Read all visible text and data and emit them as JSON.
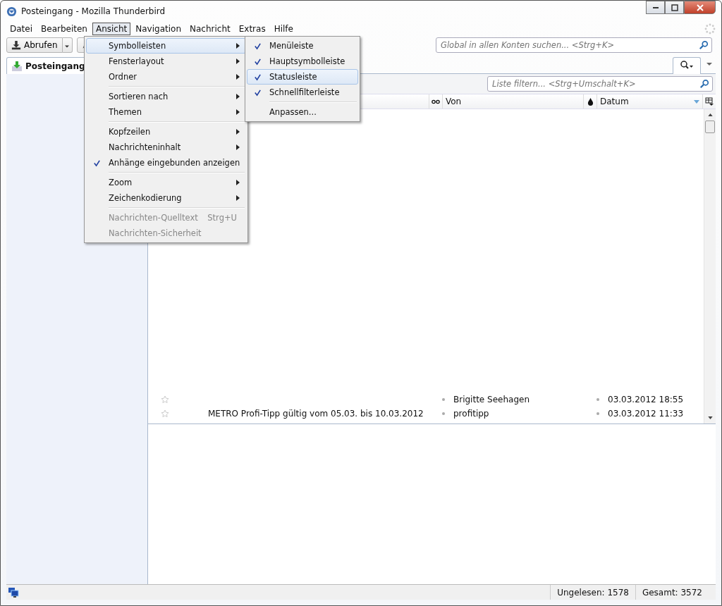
{
  "window": {
    "title": "Posteingang - Mozilla Thunderbird"
  },
  "menubar": [
    {
      "label": "Datei",
      "selected": false
    },
    {
      "label": "Bearbeiten",
      "selected": false
    },
    {
      "label": "Ansicht",
      "selected": true
    },
    {
      "label": "Navigation",
      "selected": false
    },
    {
      "label": "Nachricht",
      "selected": false
    },
    {
      "label": "Extras",
      "selected": false
    },
    {
      "label": "Hilfe",
      "selected": false
    }
  ],
  "toolbar": {
    "get_button": "Abrufen"
  },
  "global_search": {
    "placeholder": "Global in allen Konten suchen... <Strg+K>"
  },
  "tabs": [
    {
      "label": "Posteingang",
      "selected": true
    }
  ],
  "filter": {
    "placeholder": "Liste filtern... <Strg+Umschalt+K>"
  },
  "columns": [
    {
      "label": "Von"
    },
    {
      "label": "Datum"
    }
  ],
  "rows": [
    {
      "subject": "",
      "from": "Brigitte Seehagen",
      "date": "03.03.2012 18:55",
      "starred": false
    },
    {
      "subject": "METRO Profi-Tipp gültig vom 05.03. bis 10.03.2012",
      "from": "profitipp",
      "date": "03.03.2012 11:33",
      "starred": false
    }
  ],
  "view_menu": [
    {
      "kind": "submenu",
      "label": "Symbolleisten",
      "selected": true,
      "checked": false,
      "disabled": false
    },
    {
      "kind": "submenu",
      "label": "Fensterlayout",
      "selected": false,
      "checked": false,
      "disabled": false
    },
    {
      "kind": "submenu",
      "label": "Ordner",
      "selected": false,
      "checked": false,
      "disabled": false
    },
    {
      "kind": "separator"
    },
    {
      "kind": "submenu",
      "label": "Sortieren nach",
      "selected": false,
      "checked": false,
      "disabled": false
    },
    {
      "kind": "submenu",
      "label": "Themen",
      "selected": false,
      "checked": false,
      "disabled": false
    },
    {
      "kind": "separator"
    },
    {
      "kind": "submenu",
      "label": "Kopfzeilen",
      "selected": false,
      "checked": false,
      "disabled": false
    },
    {
      "kind": "submenu",
      "label": "Nachrichteninhalt",
      "selected": false,
      "checked": false,
      "disabled": false
    },
    {
      "kind": "item",
      "label": "Anhänge eingebunden anzeigen",
      "selected": false,
      "checked": true,
      "disabled": false
    },
    {
      "kind": "separator"
    },
    {
      "kind": "submenu",
      "label": "Zoom",
      "selected": false,
      "checked": false,
      "disabled": false
    },
    {
      "kind": "submenu",
      "label": "Zeichenkodierung",
      "selected": false,
      "checked": false,
      "disabled": false
    },
    {
      "kind": "separator"
    },
    {
      "kind": "item",
      "label": "Nachrichten-Quelltext",
      "shortcut": "Strg+U",
      "selected": false,
      "checked": false,
      "disabled": true
    },
    {
      "kind": "item",
      "label": "Nachrichten-Sicherheit",
      "selected": false,
      "checked": false,
      "disabled": true
    }
  ],
  "toolbars_menu": [
    {
      "kind": "item",
      "label": "Menüleiste",
      "selected": false,
      "checked": true
    },
    {
      "kind": "item",
      "label": "Hauptsymbolleiste",
      "selected": false,
      "checked": true
    },
    {
      "kind": "item",
      "label": "Statusleiste",
      "selected": true,
      "checked": true
    },
    {
      "kind": "item",
      "label": "Schnellfilterleiste",
      "selected": false,
      "checked": true
    },
    {
      "kind": "separator"
    },
    {
      "kind": "item",
      "label": "Anpassen...",
      "selected": false,
      "checked": false
    }
  ],
  "status_bar": {
    "unread": "Ungelesen: 1578",
    "total": "Gesamt: 3572"
  }
}
